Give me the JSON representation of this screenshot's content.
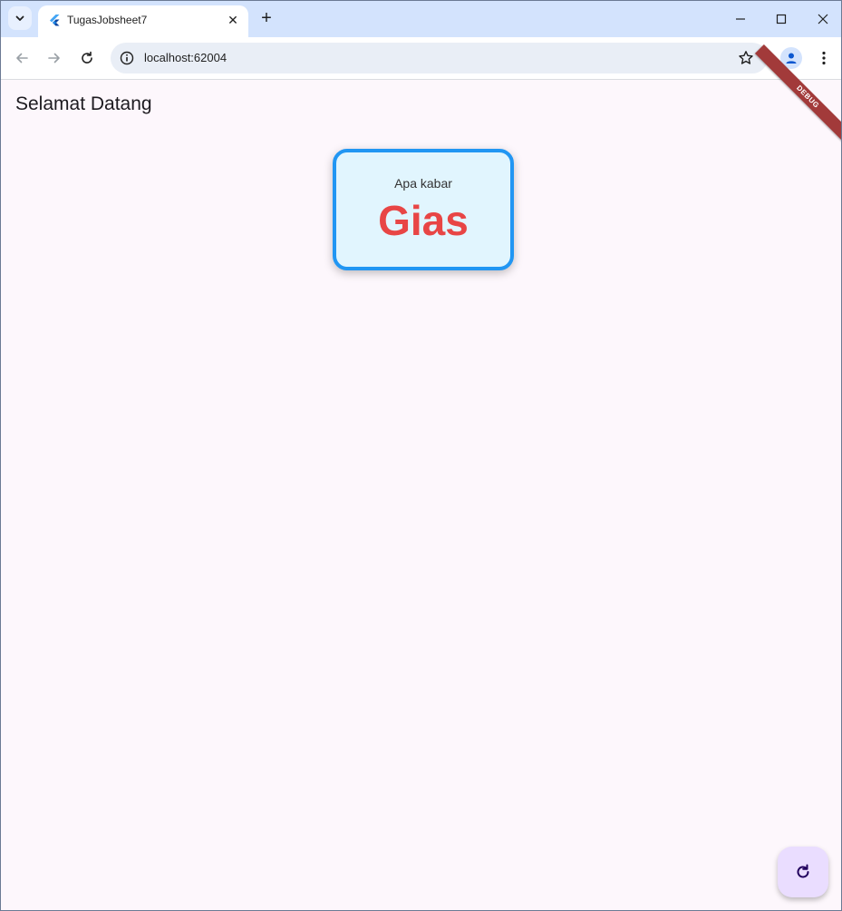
{
  "browser": {
    "tab_title": "TugasJobsheet7",
    "tab_close": "✕",
    "new_tab": "+",
    "url": "localhost:62004"
  },
  "app": {
    "appbar_title": "Selamat Datang",
    "debug_banner": "DEBUG",
    "card": {
      "greeting": "Apa kabar",
      "name": "Gias"
    },
    "fab_icon": "refresh-icon"
  },
  "colors": {
    "card_border": "#2196f3",
    "card_background": "#e1f5fe",
    "name_text": "#e84545",
    "fab_background": "#eaddff",
    "page_background": "#fdf7fc",
    "tabstrip": "#d3e3fd"
  }
}
